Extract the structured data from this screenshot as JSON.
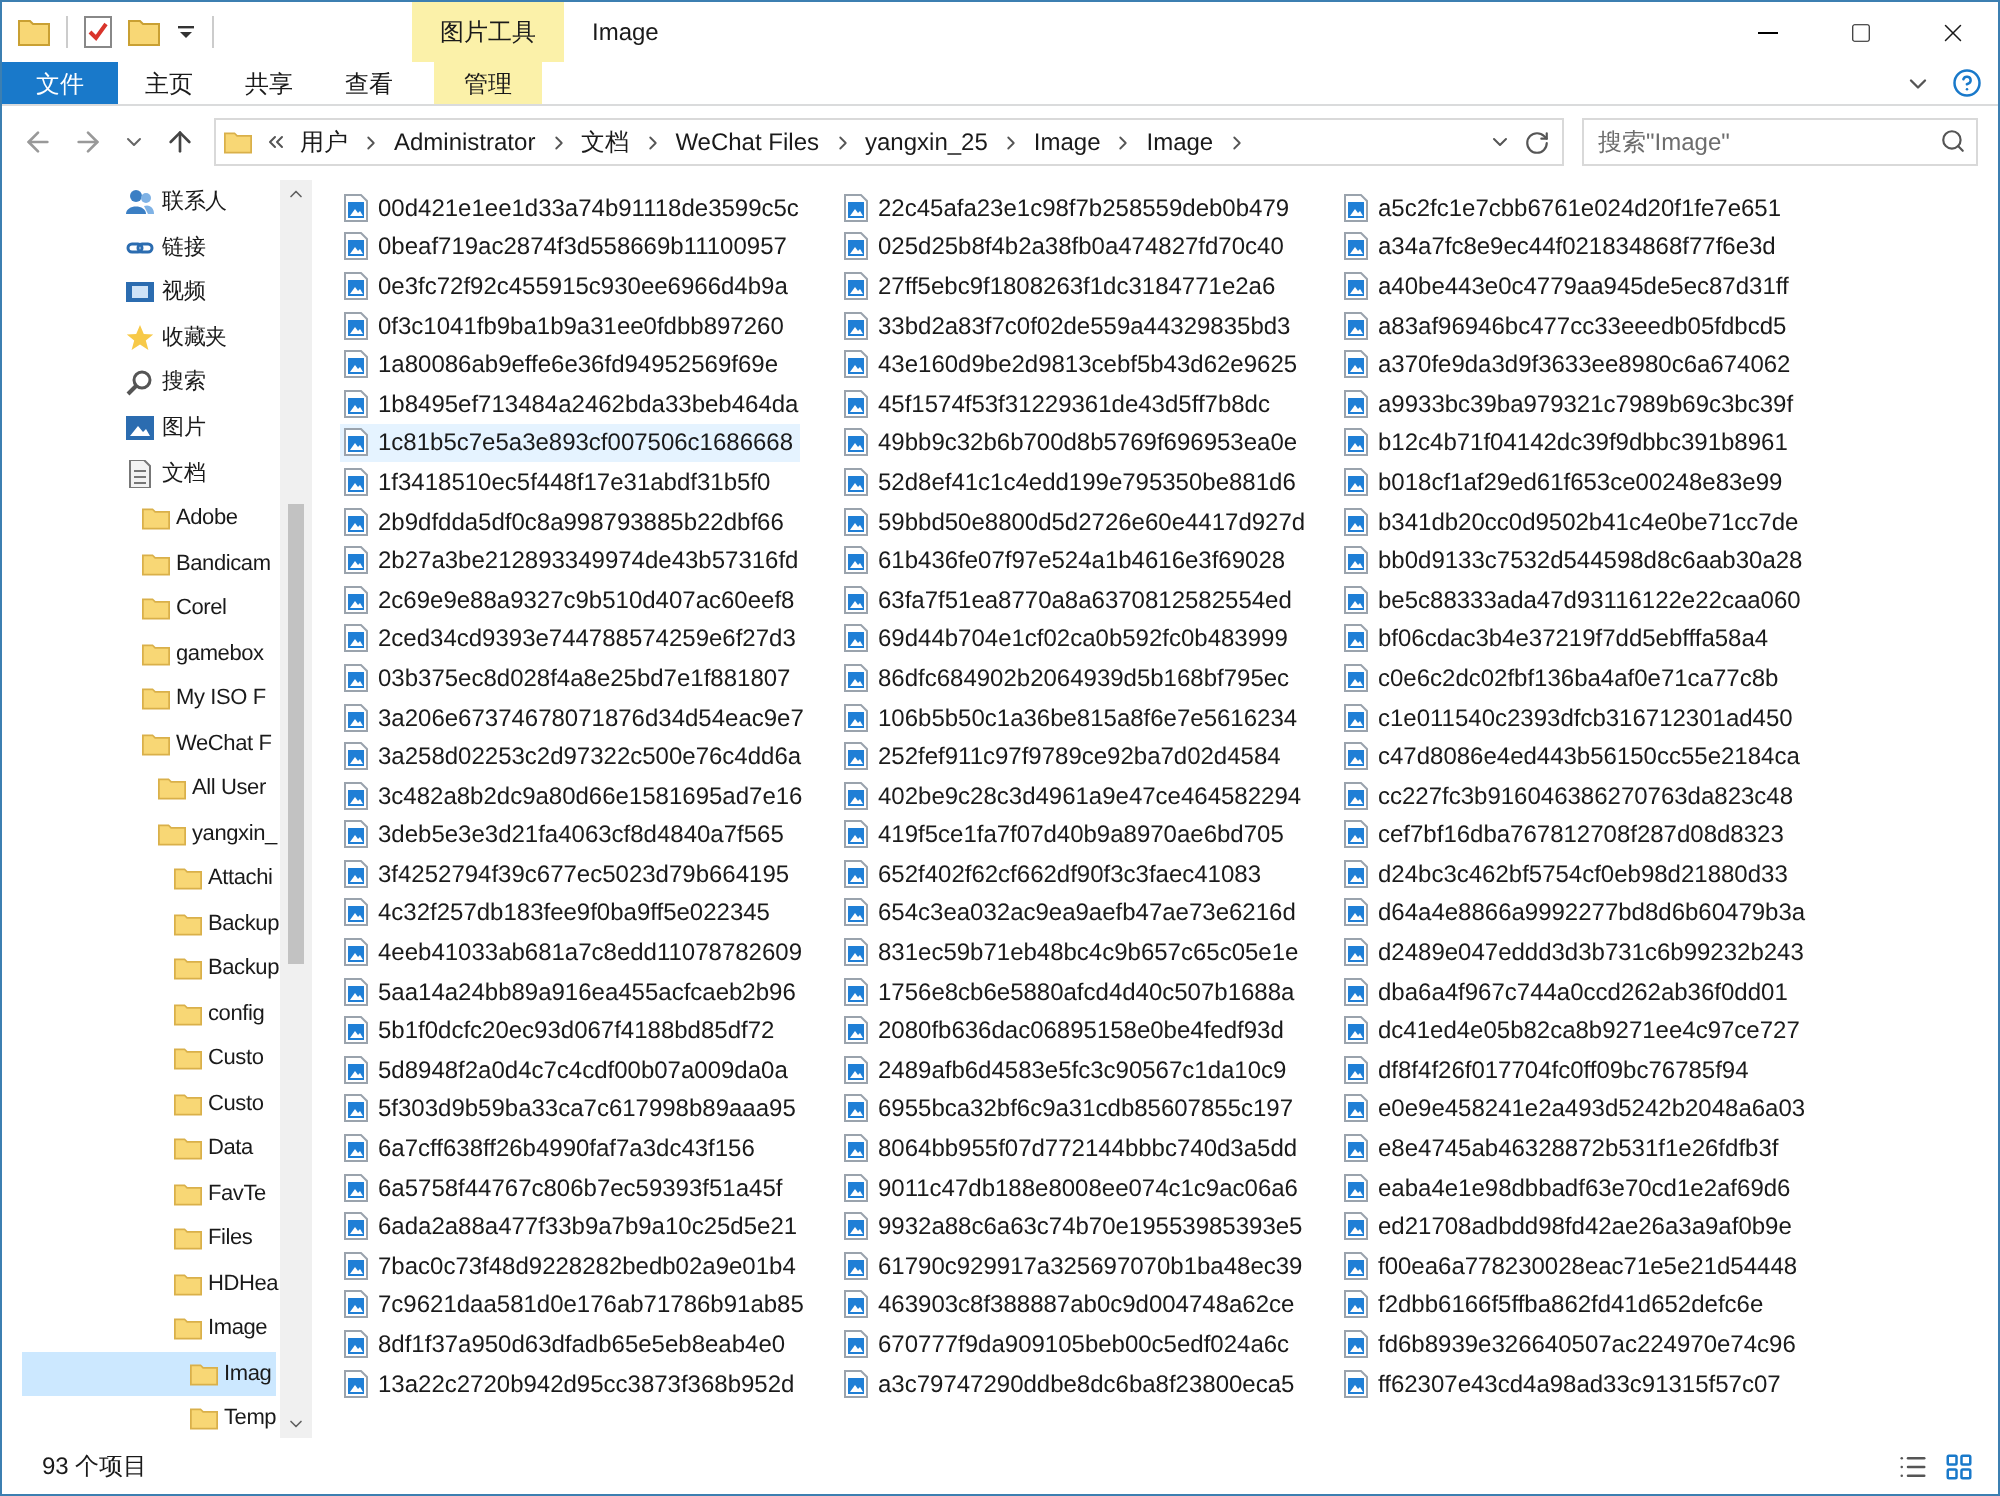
{
  "window": {
    "title": "Image",
    "context_tab": "图片工具"
  },
  "ribbon_tabs": [
    {
      "label": "文件",
      "kind": "file"
    },
    {
      "label": "主页",
      "kind": "tab"
    },
    {
      "label": "共享",
      "kind": "tab"
    },
    {
      "label": "查看",
      "kind": "tab"
    },
    {
      "label": "管理",
      "kind": "context"
    }
  ],
  "address": {
    "path": [
      "用户",
      "Administrator",
      "文档",
      "WeChat Files",
      "yangxin_25",
      "Image",
      "Image"
    ]
  },
  "search": {
    "placeholder": "搜索\"Image\""
  },
  "sidebar": {
    "groups": [
      [
        {
          "label": "联系人",
          "kind": "contacts",
          "selected": false
        },
        {
          "label": "链接",
          "kind": "link",
          "selected": false
        },
        {
          "label": "视频",
          "kind": "video",
          "selected": false
        },
        {
          "label": "收藏夹",
          "kind": "favorites",
          "selected": false
        },
        {
          "label": "搜索",
          "kind": "search",
          "selected": false
        }
      ],
      [
        {
          "label": "图片",
          "kind": "pictures",
          "selected": false
        },
        {
          "label": "文档",
          "kind": "documents",
          "selected": false,
          "children": [
            {
              "label": "Adobe",
              "kind": "folder",
              "selected": false
            },
            {
              "label": "Bandicam",
              "kind": "folder",
              "selected": false
            },
            {
              "label": "Corel",
              "kind": "folder",
              "selected": false
            },
            {
              "label": "gamebox",
              "kind": "folder",
              "selected": false
            },
            {
              "label": "My ISO F",
              "kind": "folder",
              "selected": false
            },
            {
              "label": "WeChat F",
              "kind": "folder",
              "selected": false,
              "children": [
                {
                  "label": "All User",
                  "kind": "folder",
                  "selected": false
                },
                {
                  "label": "yangxin_",
                  "kind": "folder",
                  "selected": false,
                  "children": [
                    {
                      "label": "Attachi",
                      "kind": "folder",
                      "selected": false
                    },
                    {
                      "label": "Backup",
                      "kind": "folder",
                      "selected": false
                    },
                    {
                      "label": "Backup",
                      "kind": "folder",
                      "selected": false
                    },
                    {
                      "label": "config",
                      "kind": "folder",
                      "selected": false
                    },
                    {
                      "label": "Custo",
                      "kind": "folder",
                      "selected": false
                    },
                    {
                      "label": "Custo",
                      "kind": "folder",
                      "selected": false
                    },
                    {
                      "label": "Data",
                      "kind": "folder",
                      "selected": false
                    },
                    {
                      "label": "FavTe",
                      "kind": "folder",
                      "selected": false
                    },
                    {
                      "label": "Files",
                      "kind": "folder",
                      "selected": false
                    },
                    {
                      "label": "HDHea",
                      "kind": "folder",
                      "selected": false
                    },
                    {
                      "label": "Image",
                      "kind": "folder",
                      "selected": false,
                      "children": [
                        {
                          "label": "Imag",
                          "kind": "folder",
                          "selected": true
                        },
                        {
                          "label": "Temp",
                          "kind": "folder",
                          "selected": false
                        }
                      ]
                    }
                  ]
                }
              ]
            }
          ]
        }
      ]
    ]
  },
  "files": [
    {
      "name": "00d421e1ee1d33a74b91118de3599c5c",
      "selected": false
    },
    {
      "name": "0beaf719ac2874f3d558669b11100957",
      "selected": false
    },
    {
      "name": "0e3fc72f92c455915c930ee6966d4b9a",
      "selected": false
    },
    {
      "name": "0f3c1041fb9ba1b9a31ee0fdbb897260",
      "selected": false
    },
    {
      "name": "1a80086ab9effe6e36fd94952569f69e",
      "selected": false
    },
    {
      "name": "1b8495ef713484a2462bda33beb464da",
      "selected": false
    },
    {
      "name": "1c81b5c7e5a3e893cf007506c1686668",
      "selected": true
    },
    {
      "name": "1f3418510ec5f448f17e31abdf31b5f0",
      "selected": false
    },
    {
      "name": "2b9dfdda5df0c8a998793885b22dbf66",
      "selected": false
    },
    {
      "name": "2b27a3be212893349974de43b57316fd",
      "selected": false
    },
    {
      "name": "2c69e9e88a9327c9b510d407ac60eef8",
      "selected": false
    },
    {
      "name": "2ced34cd9393e744788574259e6f27d3",
      "selected": false
    },
    {
      "name": "03b375ec8d028f4a8e25bd7e1f881807",
      "selected": false
    },
    {
      "name": "3a206e67374678071876d34d54eac9e7",
      "selected": false
    },
    {
      "name": "3a258d02253c2d97322c500e76c4dd6a",
      "selected": false
    },
    {
      "name": "3c482a8b2dc9a80d66e1581695ad7e16",
      "selected": false
    },
    {
      "name": "3deb5e3e3d21fa4063cf8d4840a7f565",
      "selected": false
    },
    {
      "name": "3f4252794f39c677ec5023d79b664195",
      "selected": false
    },
    {
      "name": "4c32f257db183fee9f0ba9ff5e022345",
      "selected": false
    },
    {
      "name": "4eeb41033ab681a7c8edd11078782609",
      "selected": false
    },
    {
      "name": "5aa14a24bb89a916ea455acfcaeb2b96",
      "selected": false
    },
    {
      "name": "5b1f0dcfc20ec93d067f4188bd85df72",
      "selected": false
    },
    {
      "name": "5d8948f2a0d4c7c4cdf00b07a009da0a",
      "selected": false
    },
    {
      "name": "5f303d9b59ba33ca7c617998b89aaa95",
      "selected": false
    },
    {
      "name": "6a7cff638ff26b4990faf7a3dc43f156",
      "selected": false
    },
    {
      "name": "6a5758f44767c806b7ec59393f51a45f",
      "selected": false
    },
    {
      "name": "6ada2a88a477f33b9a7b9a10c25d5e21",
      "selected": false
    },
    {
      "name": "7bac0c73f48d9228282bedb02a9e01b4",
      "selected": false
    },
    {
      "name": "7c9621daa581d0e176ab71786b91ab85",
      "selected": false
    },
    {
      "name": "8df1f37a950d63dfadb65e5eb8eab4e0",
      "selected": false
    },
    {
      "name": "13a22c2720b942d95cc3873f368b952d",
      "selected": false
    },
    {
      "name": "22c45afa23e1c98f7b258559deb0b479",
      "selected": false
    },
    {
      "name": "025d25b8f4b2a38fb0a474827fd70c40",
      "selected": false
    },
    {
      "name": "27ff5ebc9f1808263f1dc3184771e2a6",
      "selected": false
    },
    {
      "name": "33bd2a83f7c0f02de559a44329835bd3",
      "selected": false
    },
    {
      "name": "43e160d9be2d9813cebf5b43d62e9625",
      "selected": false
    },
    {
      "name": "45f1574f53f31229361de43d5ff7b8dc",
      "selected": false
    },
    {
      "name": "49bb9c32b6b700d8b5769f696953ea0e",
      "selected": false
    },
    {
      "name": "52d8ef41c1c4edd199e795350be881d6",
      "selected": false
    },
    {
      "name": "59bbd50e8800d5d2726e60e4417d927d",
      "selected": false
    },
    {
      "name": "61b436fe07f97e524a1b4616e3f69028",
      "selected": false
    },
    {
      "name": "63fa7f51ea8770a8a6370812582554ed",
      "selected": false
    },
    {
      "name": "69d44b704e1cf02ca0b592fc0b483999",
      "selected": false
    },
    {
      "name": "86dfc684902b2064939d5b168bf795ec",
      "selected": false
    },
    {
      "name": "106b5b50c1a36be815a8f6e7e5616234",
      "selected": false
    },
    {
      "name": "252fef911c97f9789ce92ba7d02d4584",
      "selected": false
    },
    {
      "name": "402be9c28c3d4961a9e47ce464582294",
      "selected": false
    },
    {
      "name": "419f5ce1fa7f07d40b9a8970ae6bd705",
      "selected": false
    },
    {
      "name": "652f402f62cf662df90f3c3faec41083",
      "selected": false
    },
    {
      "name": "654c3ea032ac9ea9aefb47ae73e6216d",
      "selected": false
    },
    {
      "name": "831ec59b71eb48bc4c9b657c65c05e1e",
      "selected": false
    },
    {
      "name": "1756e8cb6e5880afcd4d40c507b1688a",
      "selected": false
    },
    {
      "name": "2080fb636dac06895158e0be4fedf93d",
      "selected": false
    },
    {
      "name": "2489afb6d4583e5fc3c90567c1da10c9",
      "selected": false
    },
    {
      "name": "6955bca32bf6c9a31cdb85607855c197",
      "selected": false
    },
    {
      "name": "8064bb955f07d772144bbbc740d3a5dd",
      "selected": false
    },
    {
      "name": "9011c47db188e8008ee074c1c9ac06a6",
      "selected": false
    },
    {
      "name": "9932a88c6a63c74b70e19553985393e5",
      "selected": false
    },
    {
      "name": "61790c929917a325697070b1ba48ec39",
      "selected": false
    },
    {
      "name": "463903c8f388887ab0c9d004748a62ce",
      "selected": false
    },
    {
      "name": "670777f9da909105beb00c5edf024a6c",
      "selected": false
    },
    {
      "name": "a3c79747290ddbe8dc6ba8f23800eca5",
      "selected": false
    },
    {
      "name": "a5c2fc1e7cbb6761e024d20f1fe7e651",
      "selected": false
    },
    {
      "name": "a34a7fc8e9ec44f021834868f77f6e3d",
      "selected": false
    },
    {
      "name": "a40be443e0c4779aa945de5ec87d31ff",
      "selected": false
    },
    {
      "name": "a83af96946bc477cc33eeedb05fdbcd5",
      "selected": false
    },
    {
      "name": "a370fe9da3d9f3633ee8980c6a674062",
      "selected": false
    },
    {
      "name": "a9933bc39ba979321c7989b69c3bc39f",
      "selected": false
    },
    {
      "name": "b12c4b71f04142dc39f9dbbc391b8961",
      "selected": false
    },
    {
      "name": "b018cf1af29ed61f653ce00248e83e99",
      "selected": false
    },
    {
      "name": "b341db20cc0d9502b41c4e0be71cc7de",
      "selected": false
    },
    {
      "name": "bb0d9133c7532d544598d8c6aab30a28",
      "selected": false
    },
    {
      "name": "be5c88333ada47d93116122e22caa060",
      "selected": false
    },
    {
      "name": "bf06cdac3b4e37219f7dd5ebfffa58a4",
      "selected": false
    },
    {
      "name": "c0e6c2dc02fbf136ba4af0e71ca77c8b",
      "selected": false
    },
    {
      "name": "c1e011540c2393dfcb316712301ad450",
      "selected": false
    },
    {
      "name": "c47d8086e4ed443b56150cc55e2184ca",
      "selected": false
    },
    {
      "name": "cc227fc3b916046386270763da823c48",
      "selected": false
    },
    {
      "name": "cef7bf16dba767812708f287d08d8323",
      "selected": false
    },
    {
      "name": "d24bc3c462bf5754cf0eb98d21880d33",
      "selected": false
    },
    {
      "name": "d64a4e8866a9992277bd8d6b60479b3a",
      "selected": false
    },
    {
      "name": "d2489e047eddd3d3b731c6b99232b243",
      "selected": false
    },
    {
      "name": "dba6a4f967c744a0ccd262ab36f0dd01",
      "selected": false
    },
    {
      "name": "dc41ed4e05b82ca8b9271ee4c97ce727",
      "selected": false
    },
    {
      "name": "df8f4f26f017704fc0ff09bc76785f94",
      "selected": false
    },
    {
      "name": "e0e9e458241e2a493d5242b2048a6a03",
      "selected": false
    },
    {
      "name": "e8e4745ab46328872b531f1e26fdfb3f",
      "selected": false
    },
    {
      "name": "eaba4e1e98dbbadf63e70cd1e2af69d6",
      "selected": false
    },
    {
      "name": "ed21708adbdd98fd42ae26a3a9af0b9e",
      "selected": false
    },
    {
      "name": "f00ea6a778230028eac71e5e21d54448",
      "selected": false
    },
    {
      "name": "f2dbb6166f5ffba862fd41d652defc6e",
      "selected": false
    },
    {
      "name": "fd6b8939e326640507ac224970e74c96",
      "selected": false
    },
    {
      "name": "ff62307e43cd4a98ad33c91315f57c07",
      "selected": false
    }
  ],
  "status_bar": {
    "count": "93 个项目"
  }
}
